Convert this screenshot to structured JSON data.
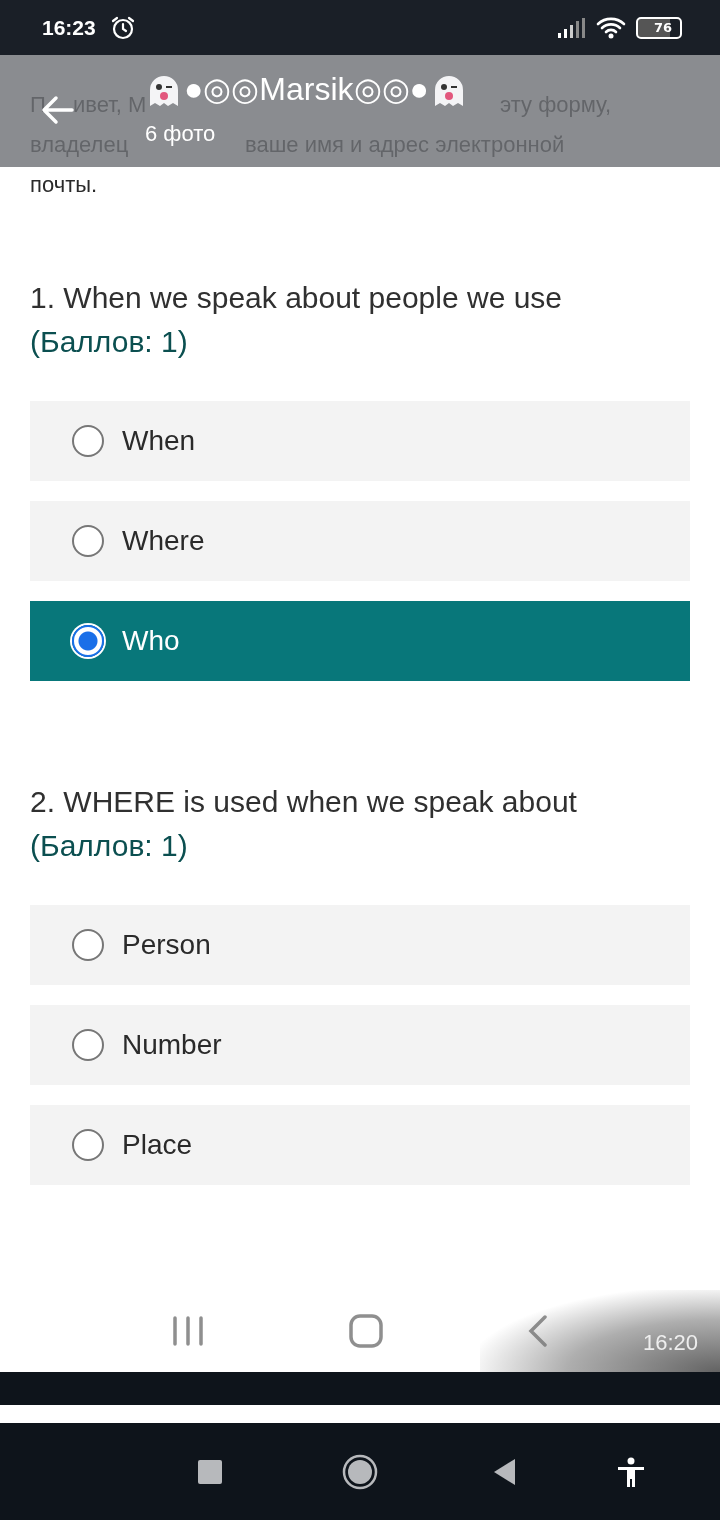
{
  "status_bar": {
    "time": "16:23",
    "battery": "76"
  },
  "viewer": {
    "title": "●◎◎Marsik◎◎●",
    "subtitle": "6 фото",
    "timestamp": "16:20"
  },
  "form": {
    "intro_lines": [
      [
        "П",
        "ивет, М",
        "эту форму,"
      ],
      [
        "владелец",
        "ваше имя и адрес электронной"
      ],
      [
        "почты."
      ]
    ],
    "questions": [
      {
        "text": "1. When we speak about people we use",
        "points": "(Баллов: 1)",
        "options": [
          {
            "label": "When",
            "selected": false
          },
          {
            "label": "Where",
            "selected": false
          },
          {
            "label": "Who",
            "selected": true
          }
        ]
      },
      {
        "text": "2. WHERE is used when we speak about",
        "points": "(Баллов: 1)",
        "options": [
          {
            "label": "Person",
            "selected": false
          },
          {
            "label": "Number",
            "selected": false
          },
          {
            "label": "Place",
            "selected": false
          }
        ]
      }
    ]
  }
}
